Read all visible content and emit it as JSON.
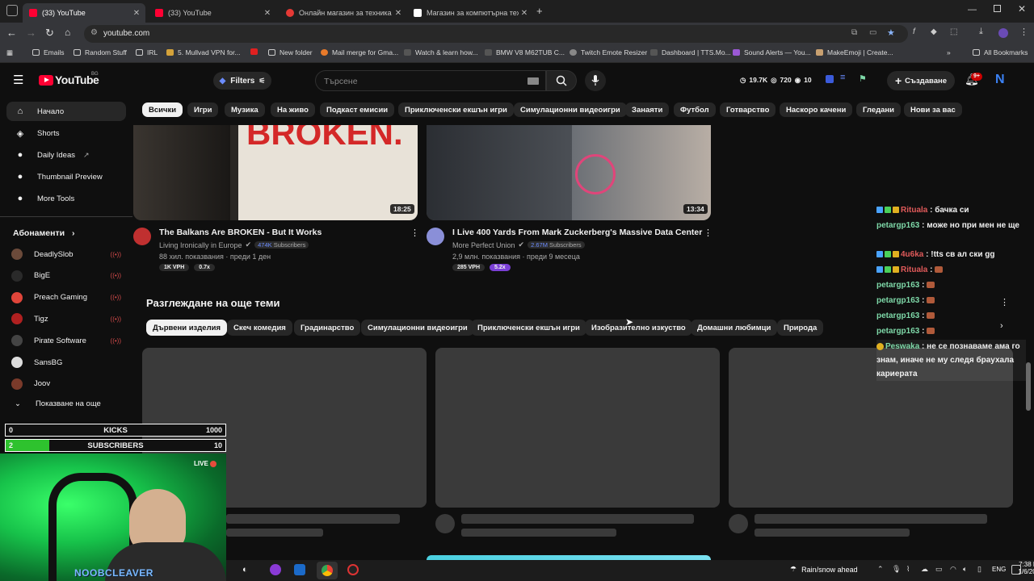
{
  "browser": {
    "tabs": [
      {
        "title": "(33) YouTube",
        "favicon_color": "#ff0033"
      },
      {
        "title": "(33) YouTube",
        "favicon_color": "#ff0033"
      },
      {
        "title": "Онлайн магазин за техника - /",
        "favicon_color": "#e53935"
      },
      {
        "title": "Магазин за компютърна техн...",
        "favicon_color": "#ffffff"
      }
    ],
    "url": "youtube.com",
    "bookmarks": [
      "Emails",
      "Random Stuff",
      "IRL",
      "5. Mullvad VPN for...",
      "New folder",
      "Mail merge for Gma...",
      "Watch & learn how...",
      "BMW V8 M62TUB C...",
      "Twitch Emote Resizer",
      "Dashboard | TTS.Mo...",
      "Sound Alerts — You...",
      "MakeEmoji | Create..."
    ],
    "all_bookmarks": "All Bookmarks"
  },
  "youtube": {
    "logo_text": "YouTube",
    "logo_region": "BG",
    "filters_label": "Filters",
    "search_placeholder": "Търсене",
    "stats": {
      "views": "19.7K",
      "watching": "720",
      "count": "10"
    },
    "create_label": "Създаване",
    "notif_count": "9+",
    "avatar_letter": "N",
    "chips": [
      "Всички",
      "Игри",
      "Музика",
      "На живо",
      "Подкаст емисии",
      "Приключенски екшън игри",
      "Симулационни видеоигри",
      "Занаяти",
      "Футбол",
      "Готварство",
      "Наскоро качени",
      "Гледани",
      "Нови за вас"
    ],
    "sidebar": {
      "main": [
        {
          "label": "Начало",
          "icon": "home-icon"
        },
        {
          "label": "Shorts",
          "icon": "shorts-icon"
        },
        {
          "label": "Daily Ideas",
          "icon": "ideas-icon"
        },
        {
          "label": "Thumbnail Preview",
          "icon": "thumbnail-icon"
        },
        {
          "label": "More Tools",
          "icon": "tools-icon"
        }
      ],
      "subs_title": "Абонаменти",
      "subs": [
        {
          "name": "DeadlySlob",
          "color": "#6b4a3a",
          "live": true
        },
        {
          "name": "BigE",
          "color": "#2a2a2a",
          "live": true
        },
        {
          "name": "Preach Gaming",
          "color": "#e0453a",
          "live": true
        },
        {
          "name": "Tigz",
          "color": "#b02020",
          "live": true
        },
        {
          "name": "Pirate Software",
          "color": "#444444",
          "live": true
        },
        {
          "name": "SansBG",
          "color": "#dddddd",
          "live": false
        },
        {
          "name": "Joov",
          "color": "#7a3a2a",
          "live": false
        }
      ],
      "show_more": "Показване на още"
    },
    "videos": [
      {
        "title": "The Balkans Are BROKEN - But It Works",
        "channel": "Living Ironically in Europe",
        "subs": "474K",
        "subs_suffix": "Subscribers",
        "meta": "88 хил. показвания · преди 1 ден",
        "duration": "18:25",
        "vph": "1K VPH",
        "ratio": "0.7x",
        "thumb_text": "BROKEN."
      },
      {
        "title": "I Live 400 Yards From Mark Zuckerberg's Massive Data Center",
        "channel": "More Perfect Union",
        "subs": "2.67M",
        "subs_suffix": "Subscribers",
        "meta": "2,9 млн. показвания · преди 9 месеца",
        "duration": "13:34",
        "vph": "285 VPH",
        "ratio": "5.2x"
      }
    ],
    "explore_title": "Разглеждане на още теми",
    "explore_chips": [
      "Дървени изделия",
      "Скеч комедия",
      "Градинарство",
      "Симулационни видеоигри",
      "Приключенски екшън игри",
      "Изобразително изкуство",
      "Домашни любимци",
      "Природа"
    ]
  },
  "overlay": {
    "kicks": {
      "label": "KICKS",
      "current": "0",
      "goal": "1000",
      "progress": 0.0
    },
    "subscribers": {
      "label": "SUBSCRIBERS",
      "current": "2",
      "goal": "10",
      "progress": 0.2
    },
    "live_label": "LIVE",
    "streamer_name": "NOOBCLEAVER"
  },
  "chat": [
    {
      "user": "Rituala",
      "text": "бачка си",
      "user_color": "#e05a5a"
    },
    {
      "user": "petargp163",
      "text": "може но при мен не ще",
      "user_color": "#7ed8a8"
    },
    {
      "user": "4u6ka",
      "text": "!tts св ал ски gg",
      "user_color": "#e05a5a"
    },
    {
      "user": "Rituala",
      "text": "",
      "user_color": "#e05a5a"
    },
    {
      "user": "petargp163",
      "text": "",
      "user_color": "#7ed8a8"
    },
    {
      "user": "petargp163",
      "text": "",
      "user_color": "#7ed8a8"
    },
    {
      "user": "petargp163",
      "text": "",
      "user_color": "#7ed8a8"
    },
    {
      "user": "petargp163",
      "text": "",
      "user_color": "#7ed8a8"
    },
    {
      "user": "Peswaka",
      "text": "не се познаваме ама го знам, иначе не му следя браухала кариерата",
      "user_color": "#7ed8a8"
    }
  ],
  "taskbar": {
    "weather": "Rain/snow ahead",
    "lang": "ENG",
    "time": "7:38 PM",
    "date": "1/6/2026"
  }
}
